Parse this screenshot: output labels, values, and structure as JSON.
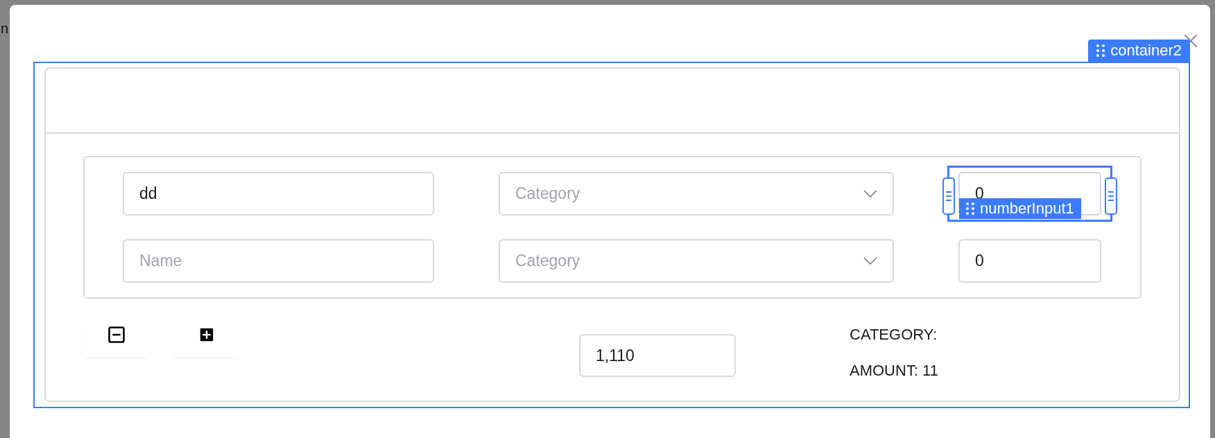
{
  "backdrop": {
    "edge_text": "n"
  },
  "editor": {
    "container_label": "container2",
    "input_label": "numberInput1"
  },
  "rows": [
    {
      "name": {
        "value": "dd"
      },
      "category": {
        "placeholder": "Category"
      },
      "amount": {
        "value": "0"
      },
      "selected": true
    },
    {
      "name": {
        "placeholder": "Name"
      },
      "category": {
        "placeholder": "Category"
      },
      "amount": {
        "value": "0"
      },
      "selected": false
    }
  ],
  "total": {
    "value": "1,110"
  },
  "summary": [
    "CATEGORY:",
    "AMOUNT: 11"
  ]
}
